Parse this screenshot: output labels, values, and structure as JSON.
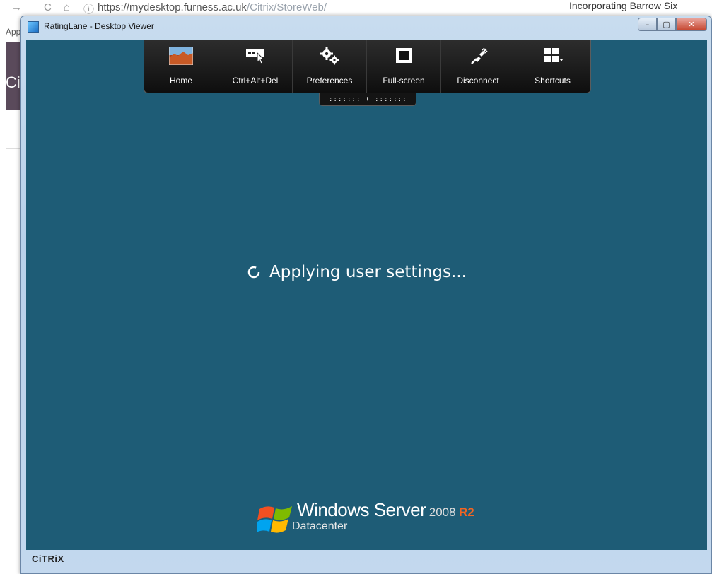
{
  "background_browser": {
    "url_host": "https://mydesktop.furness.ac.uk",
    "url_path": "/Citrix/StoreWeb/",
    "apps_label": "Apps",
    "side_letters": "Ci",
    "right_text": "Incorporating Barrow Six"
  },
  "window": {
    "title": "RatingLane - Desktop Viewer",
    "minimize_glyph": "–",
    "maximize_glyph": "▢",
    "close_glyph": "✕"
  },
  "toolbar": {
    "items": [
      {
        "label": "Home",
        "icon": "home-icon"
      },
      {
        "label": "Ctrl+Alt+Del",
        "icon": "ctrl-alt-del-icon"
      },
      {
        "label": "Preferences",
        "icon": "gears-icon"
      },
      {
        "label": "Full-screen",
        "icon": "fullscreen-icon"
      },
      {
        "label": "Disconnect",
        "icon": "disconnect-plug-icon"
      },
      {
        "label": "Shortcuts",
        "icon": "shortcuts-grid-icon"
      }
    ],
    "handle_text": "::::::: ⬆ :::::::"
  },
  "desktop": {
    "status_text": "Applying user settings...",
    "brand_main": "Windows Server",
    "brand_version": "2008",
    "brand_r2": "R2",
    "brand_edition": "Datacenter",
    "background_color": "#1e5c76"
  },
  "footer": {
    "logo_text": "CiTRiX"
  }
}
